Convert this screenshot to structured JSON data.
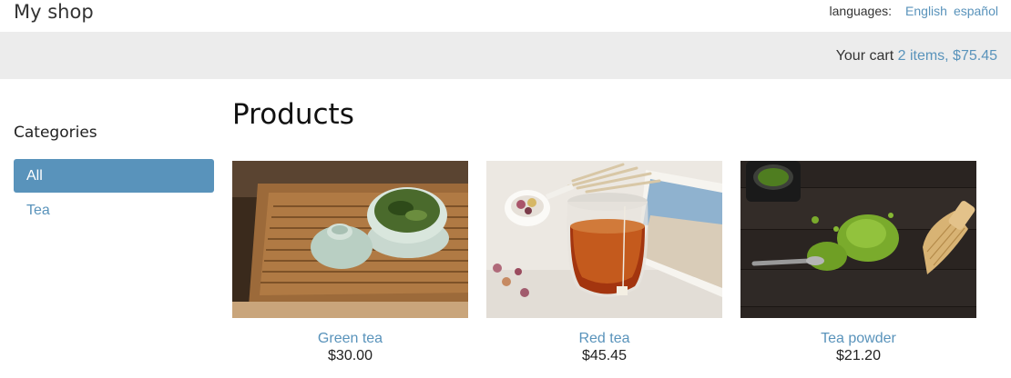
{
  "header": {
    "logo": "My shop",
    "languages_label": "languages:",
    "languages": [
      "English",
      "español"
    ]
  },
  "cart": {
    "label": "Your cart",
    "summary": "2 items, $75.45"
  },
  "sidebar": {
    "title": "Categories",
    "categories": [
      {
        "label": "All",
        "active": true
      },
      {
        "label": "Tea",
        "active": false
      }
    ]
  },
  "main": {
    "title": "Products",
    "products": [
      {
        "name": "Green tea",
        "price": "$30.00",
        "image": "green-tea-photo"
      },
      {
        "name": "Red tea",
        "price": "$45.45",
        "image": "red-tea-photo"
      },
      {
        "name": "Tea powder",
        "price": "$21.20",
        "image": "tea-powder-photo"
      }
    ]
  },
  "colors": {
    "accent": "#5993bb",
    "subheader_bg": "#ececec",
    "text": "#333333"
  }
}
